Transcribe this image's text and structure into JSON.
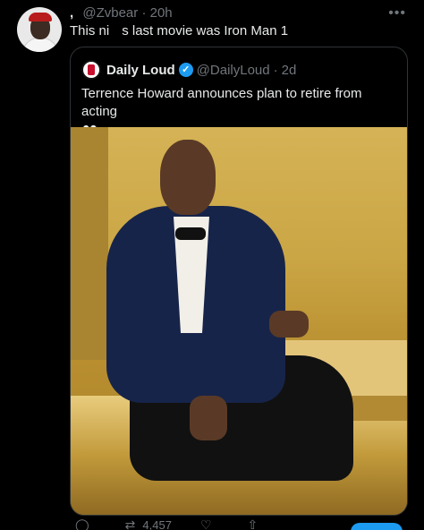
{
  "post": {
    "display_name_fragment": ",",
    "handle": "@Zvbear",
    "separator": "·",
    "time": "20h",
    "more_icon": "more-horizontal-icon",
    "text_before": "This ni",
    "text_after": "s last movie was Iron Man 1"
  },
  "quoted": {
    "name": "Daily Loud",
    "verified_mark": "✓",
    "handle": "@DailyLoud",
    "separator": "·",
    "time": "2d",
    "text": "Terrence Howard announces plan to retire from acting",
    "emoji": "👀"
  },
  "actions": {
    "reply_count": "",
    "retweet_count": "4,457",
    "like_count": "",
    "reply_icon": "reply-icon",
    "retweet_icon": "retweet-icon",
    "like_icon": "heart-icon",
    "share_icon": "share-icon"
  },
  "colors": {
    "background": "#000000",
    "text": "#e7e9ea",
    "muted": "#71767b",
    "accent": "#1d9bf0"
  }
}
